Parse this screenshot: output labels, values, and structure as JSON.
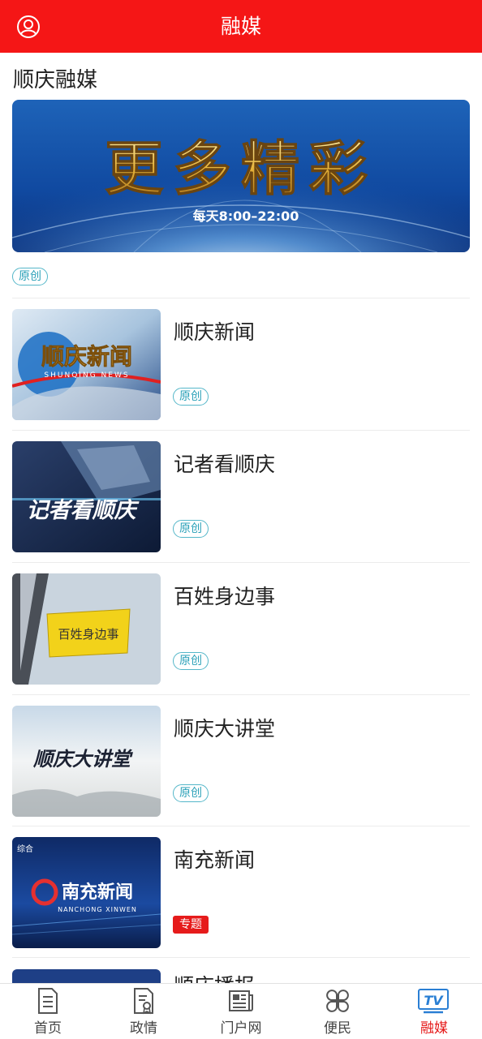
{
  "header": {
    "title": "融媒",
    "user_icon": "user-circle-icon",
    "background_color": "#f51616"
  },
  "section": {
    "title": "顺庆融媒"
  },
  "banner": {
    "headline": "更多精彩",
    "subline": "每天8:00–22:00",
    "tag": "原创"
  },
  "items": [
    {
      "title": "顺庆新闻",
      "tag": "原创",
      "tag_style": "outline",
      "thumb_text": "顺庆新闻",
      "thumb_subtext": "SHUNQING NEWS"
    },
    {
      "title": "记者看顺庆",
      "tag": "原创",
      "tag_style": "outline",
      "thumb_text": "记者看顺庆"
    },
    {
      "title": "百姓身边事",
      "tag": "原创",
      "tag_style": "outline",
      "thumb_text": "百姓身边事"
    },
    {
      "title": "顺庆大讲堂",
      "tag": "原创",
      "tag_style": "outline",
      "thumb_text": "顺庆大讲堂"
    },
    {
      "title": "南充新闻",
      "tag": "专题",
      "tag_style": "red",
      "thumb_text": "南充新闻",
      "thumb_subtext": "NANCHONG XINWEN",
      "thumb_corner": "综合"
    }
  ],
  "partial_item": {
    "title": "顺庆播报"
  },
  "bottom_nav": {
    "items": [
      {
        "label": "首页",
        "icon": "document-icon",
        "active": false
      },
      {
        "label": "政情",
        "icon": "certificate-icon",
        "active": false
      },
      {
        "label": "门户网",
        "icon": "newspaper-icon",
        "active": false
      },
      {
        "label": "便民",
        "icon": "clover-grid-icon",
        "active": false
      },
      {
        "label": "融媒",
        "icon": "tv-icon",
        "active": true
      }
    ],
    "active_color": "#e61b1b"
  }
}
